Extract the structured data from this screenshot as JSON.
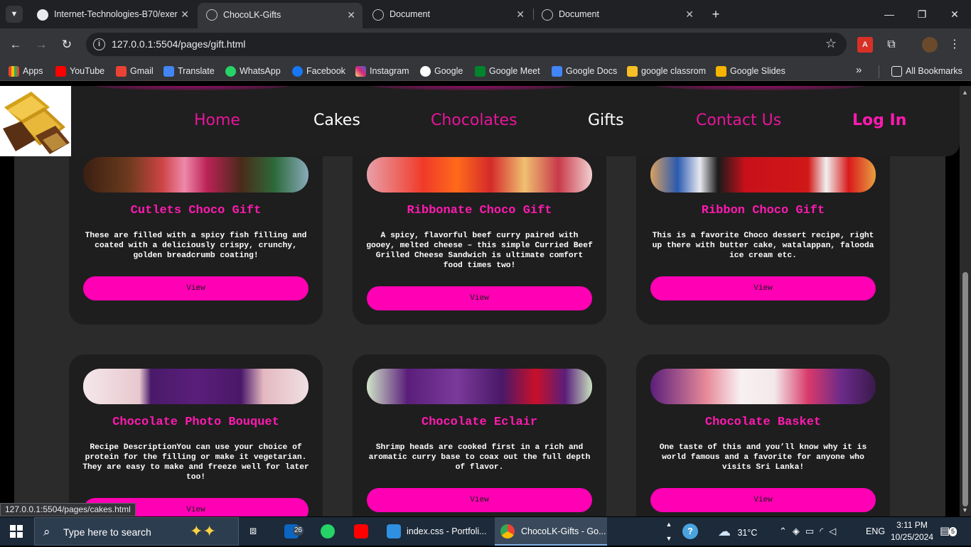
{
  "browser": {
    "tabs": [
      {
        "title": "Internet-Technologies-B70/exer",
        "icon": "github-icon"
      },
      {
        "title": "ChocoLK-Gifts",
        "icon": "globe-icon"
      },
      {
        "title": "Document",
        "icon": "globe-icon"
      },
      {
        "title": "Document",
        "icon": "globe-icon"
      }
    ],
    "url": "127.0.0.1:5504/pages/gift.html",
    "bookmarks": [
      "Apps",
      "YouTube",
      "Gmail",
      "Translate",
      "WhatsApp",
      "Facebook",
      "Instagram",
      "Google",
      "Google Meet",
      "Google Docs",
      "google classrom",
      "Google Slides"
    ],
    "all_bookmarks": "All Bookmarks",
    "status_url": "127.0.0.1:5504/pages/cakes.html"
  },
  "site": {
    "nav": {
      "home": "Home",
      "cakes": "Cakes",
      "chocolates": "Chocolates",
      "gifts": "Gifts",
      "contact": "Contact Us",
      "login": "Log In"
    },
    "cards": [
      {
        "title": "Cutlets Choco Gift",
        "desc": "These are filled with a spicy fish filling and coated with a deliciously crispy, crunchy, golden breadcrumb coating!",
        "button": "View"
      },
      {
        "title": "Ribbonate Choco Gift",
        "desc": "A spicy, flavorful beef curry paired with gooey, melted cheese – this simple Curried Beef Grilled Cheese Sandwich is ultimate comfort food times two!",
        "button": "View"
      },
      {
        "title": "Ribbon Choco Gift",
        "desc": "This is a favorite Choco dessert recipe, right up there with butter cake, watalappan, falooda ice cream etc.",
        "button": "View"
      },
      {
        "title": "Chocolate Photo Bouquet",
        "desc": "Recipe DescriptionYou can use your choice of protein for the filling or make it vegetarian. They are easy to make and freeze well for later too!",
        "button": "View"
      },
      {
        "title": "Chocolate Eclair",
        "desc": "Shrimp heads are cooked first in a rich and aromatic curry base to coax out the full depth of flavor.",
        "button": "View"
      },
      {
        "title": "Chocolate Basket",
        "desc": "One taste of this and you’ll know why it is world famous and a favorite for anyone who visits Sri Lanka!",
        "button": "View"
      }
    ],
    "colors": {
      "accent": "#ff00b4",
      "card_bg": "#1e1e1e",
      "panel_bg": "#2b2b2b"
    }
  },
  "taskbar": {
    "search_placeholder": "Type here to search",
    "linkedin_badge": "26",
    "apps": [
      {
        "label": "index.css - Portfoli..."
      },
      {
        "label": "ChocoLK-Gifts - Go..."
      }
    ],
    "weather": "31°C",
    "language": "ENG",
    "time": "3:11 PM",
    "date": "10/25/2024",
    "notifications": "5"
  }
}
